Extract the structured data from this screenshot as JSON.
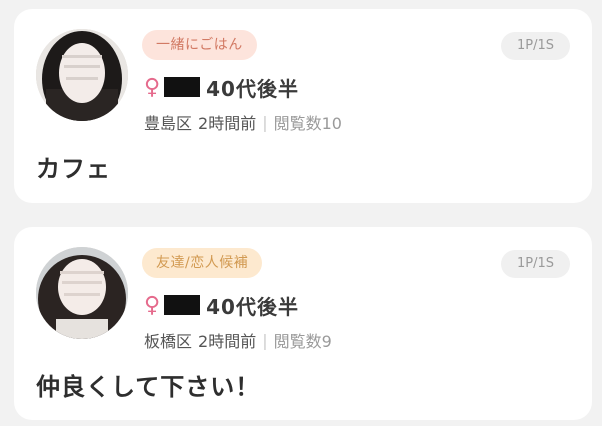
{
  "posts": [
    {
      "tag": "一緒にごはん",
      "tag_bg": "#fde4dc",
      "tag_color": "#d27a64",
      "page": "1P/1S",
      "gender_symbol": "♀",
      "age": "40代後半",
      "area": "豊島区",
      "time": "2時間前",
      "views": "閲覧数10",
      "message": "カフェ"
    },
    {
      "tag": "友達/恋人候補",
      "tag_bg": "#fde9cf",
      "tag_color": "#d29a52",
      "page": "1P/1S",
      "gender_symbol": "♀",
      "age": "40代後半",
      "area": "板橋区",
      "time": "2時間前",
      "views": "閲覧数9",
      "message": "仲良くして下さい！"
    }
  ],
  "separator": "|",
  "accent_female": "#e56a8c"
}
